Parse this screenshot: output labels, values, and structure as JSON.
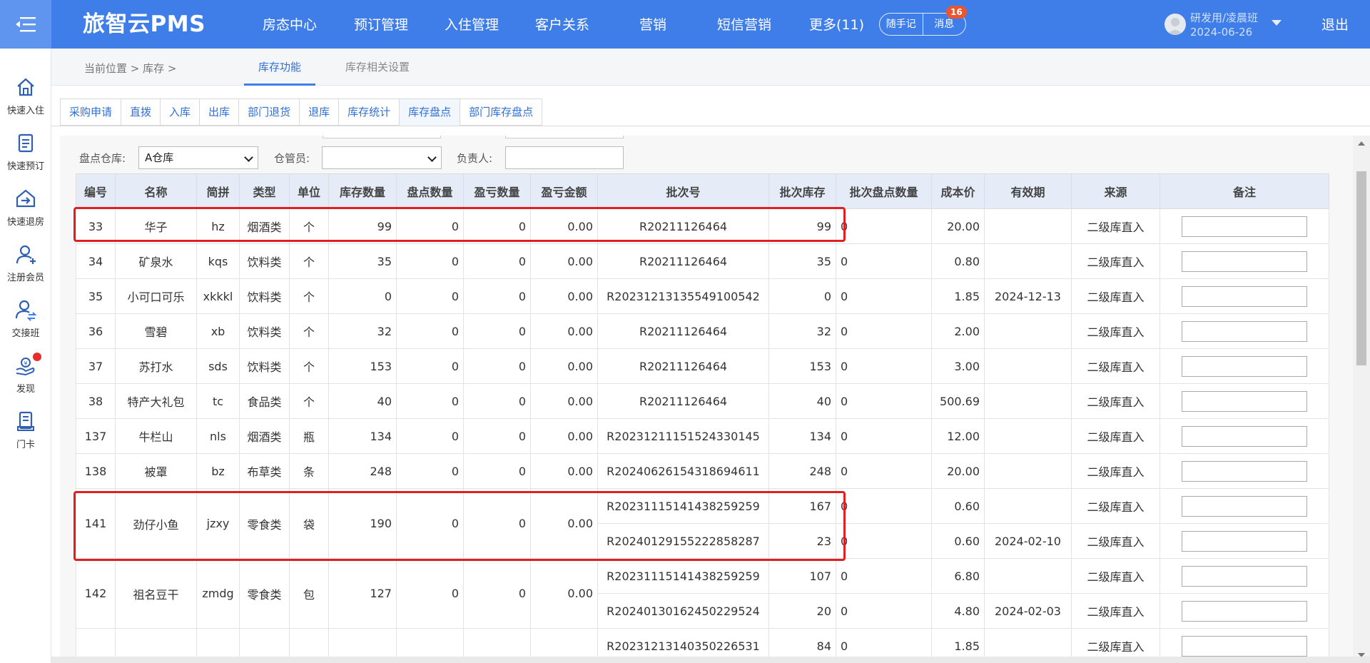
{
  "app": {
    "brand": "旅智云PMS"
  },
  "nav": [
    "房态中心",
    "预订管理",
    "入住管理",
    "客户关系",
    "营销",
    "短信营销",
    "更多(11)"
  ],
  "pills": {
    "notes": "随手记",
    "messages": "消息",
    "message_count": "16"
  },
  "user": {
    "name": "研发用/凌晨班",
    "date": "2024-06-26"
  },
  "logout": "退出",
  "sidebar": [
    {
      "label": "快速入住",
      "icon": "home-icon"
    },
    {
      "label": "快速预订",
      "icon": "clipboard-icon"
    },
    {
      "label": "快速退房",
      "icon": "checkout-house-icon"
    },
    {
      "label": "注册会员",
      "icon": "user-add-icon"
    },
    {
      "label": "交接班",
      "icon": "user-swap-icon"
    },
    {
      "label": "发现",
      "icon": "hand-coin-icon"
    },
    {
      "label": "门卡",
      "icon": "card-icon"
    }
  ],
  "breadcrumb": {
    "text": "当前位置 > 库存 >"
  },
  "top_tabs": [
    {
      "label": "库存功能",
      "active": true
    },
    {
      "label": "库存相关设置",
      "active": false
    }
  ],
  "sub_tabs": [
    {
      "label": "采购申请",
      "active": false
    },
    {
      "label": "直拨",
      "active": false
    },
    {
      "label": "入库",
      "active": false
    },
    {
      "label": "出库",
      "active": false
    },
    {
      "label": "部门退货",
      "active": false
    },
    {
      "label": "退库",
      "active": false
    },
    {
      "label": "库存统计",
      "active": false
    },
    {
      "label": "库存盘点",
      "active": true
    },
    {
      "label": "部门库存盘点",
      "active": false
    }
  ],
  "filters": {
    "warehouse_label": "盘点仓库:",
    "warehouse_value": "A仓库",
    "keeper_label": "仓管员:",
    "keeper_value": "",
    "owner_label": "负责人:",
    "owner_value": ""
  },
  "table": {
    "columns": [
      "编号",
      "名称",
      "简拼",
      "类型",
      "单位",
      "库存数量",
      "盘点数量",
      "盈亏数量",
      "盈亏金额",
      "批次号",
      "批次库存",
      "批次盘点数量",
      "成本价",
      "有效期",
      "来源",
      "备注"
    ],
    "rows": [
      {
        "id": "33",
        "name": "华子",
        "abbr": "hz",
        "type": "烟酒类",
        "unit": "个",
        "stock": "99",
        "counted": "0",
        "diff": "0",
        "diff_amount": "0.00",
        "batches": [
          {
            "batch": "R20211126464",
            "batch_stock": "99",
            "batch_count": "0",
            "cost": "20.00",
            "expiry": "",
            "source": "二级库直入"
          }
        ]
      },
      {
        "id": "34",
        "name": "矿泉水",
        "abbr": "kqs",
        "type": "饮料类",
        "unit": "个",
        "stock": "35",
        "counted": "0",
        "diff": "0",
        "diff_amount": "0.00",
        "batches": [
          {
            "batch": "R20211126464",
            "batch_stock": "35",
            "batch_count": "0",
            "cost": "0.80",
            "expiry": "",
            "source": "二级库直入"
          }
        ]
      },
      {
        "id": "35",
        "name": "小可口可乐",
        "abbr": "xkkkl",
        "type": "饮料类",
        "unit": "个",
        "stock": "0",
        "counted": "0",
        "diff": "0",
        "diff_amount": "0.00",
        "batches": [
          {
            "batch": "R20231213135549100542",
            "batch_stock": "0",
            "batch_count": "0",
            "cost": "1.85",
            "expiry": "2024-12-13",
            "source": "二级库直入"
          }
        ]
      },
      {
        "id": "36",
        "name": "雪碧",
        "abbr": "xb",
        "type": "饮料类",
        "unit": "个",
        "stock": "32",
        "counted": "0",
        "diff": "0",
        "diff_amount": "0.00",
        "batches": [
          {
            "batch": "R20211126464",
            "batch_stock": "32",
            "batch_count": "0",
            "cost": "2.00",
            "expiry": "",
            "source": "二级库直入"
          }
        ]
      },
      {
        "id": "37",
        "name": "苏打水",
        "abbr": "sds",
        "type": "饮料类",
        "unit": "个",
        "stock": "153",
        "counted": "0",
        "diff": "0",
        "diff_amount": "0.00",
        "batches": [
          {
            "batch": "R20211126464",
            "batch_stock": "153",
            "batch_count": "0",
            "cost": "3.00",
            "expiry": "",
            "source": "二级库直入"
          }
        ]
      },
      {
        "id": "38",
        "name": "特产大礼包",
        "abbr": "tc",
        "type": "食品类",
        "unit": "个",
        "stock": "40",
        "counted": "0",
        "diff": "0",
        "diff_amount": "0.00",
        "batches": [
          {
            "batch": "R20211126464",
            "batch_stock": "40",
            "batch_count": "0",
            "cost": "500.69",
            "expiry": "",
            "source": "二级库直入"
          }
        ]
      },
      {
        "id": "137",
        "name": "牛栏山",
        "abbr": "nls",
        "type": "烟酒类",
        "unit": "瓶",
        "stock": "134",
        "counted": "0",
        "diff": "0",
        "diff_amount": "0.00",
        "batches": [
          {
            "batch": "R20231211151524330145",
            "batch_stock": "134",
            "batch_count": "0",
            "cost": "12.00",
            "expiry": "",
            "source": "二级库直入"
          }
        ]
      },
      {
        "id": "138",
        "name": "被罩",
        "abbr": "bz",
        "type": "布草类",
        "unit": "条",
        "stock": "248",
        "counted": "0",
        "diff": "0",
        "diff_amount": "0.00",
        "batches": [
          {
            "batch": "R20240626154318694611",
            "batch_stock": "248",
            "batch_count": "0",
            "cost": "20.00",
            "expiry": "",
            "source": "二级库直入"
          }
        ]
      },
      {
        "id": "141",
        "name": "劲仔小鱼",
        "abbr": "jzxy",
        "type": "零食类",
        "unit": "袋",
        "stock": "190",
        "counted": "0",
        "diff": "0",
        "diff_amount": "0.00",
        "batches": [
          {
            "batch": "R20231115141438259259",
            "batch_stock": "167",
            "batch_count": "0",
            "cost": "0.60",
            "expiry": "",
            "source": "二级库直入"
          },
          {
            "batch": "R20240129155222858287",
            "batch_stock": "23",
            "batch_count": "0",
            "cost": "0.60",
            "expiry": "2024-02-10",
            "source": "二级库直入"
          }
        ]
      },
      {
        "id": "142",
        "name": "祖名豆干",
        "abbr": "zmdg",
        "type": "零食类",
        "unit": "包",
        "stock": "127",
        "counted": "0",
        "diff": "0",
        "diff_amount": "0.00",
        "batches": [
          {
            "batch": "R20231115141438259259",
            "batch_stock": "107",
            "batch_count": "0",
            "cost": "6.80",
            "expiry": "",
            "source": "二级库直入"
          },
          {
            "batch": "R20240130162450229524",
            "batch_stock": "20",
            "batch_count": "0",
            "cost": "4.80",
            "expiry": "2024-02-03",
            "source": "二级库直入"
          }
        ]
      },
      {
        "id": "",
        "name": "",
        "abbr": "",
        "type": "",
        "unit": "",
        "stock": "",
        "counted": "",
        "diff": "",
        "diff_amount": "",
        "batches": [
          {
            "batch": "R20231213140350226531",
            "batch_stock": "84",
            "batch_count": "0",
            "cost": "1.85",
            "expiry": "",
            "source": "二级库直入"
          }
        ]
      }
    ]
  },
  "colors": {
    "topbar": "#3f7ee8",
    "accent": "#2e6fd8",
    "highlight": "#e02020",
    "header_bg": "#e5ecf7"
  }
}
